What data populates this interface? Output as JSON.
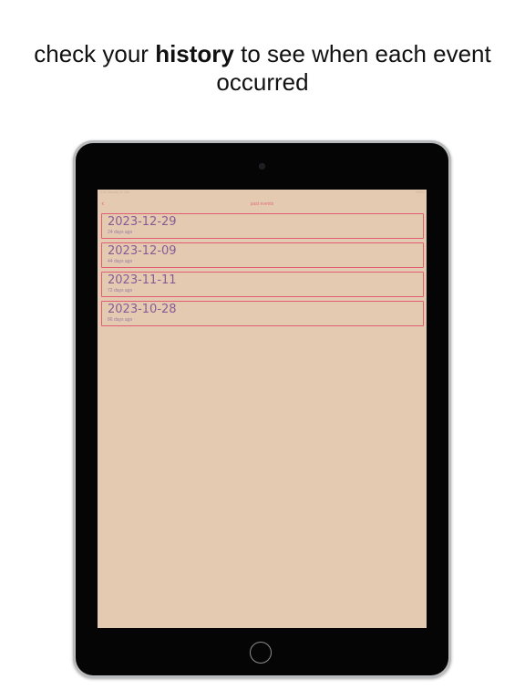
{
  "headline": {
    "prefix": "check your ",
    "emphasis": "history",
    "suffix": " to see when each event occurred"
  },
  "status_bar": {
    "left": "9:41  Monday 22 Jan",
    "right": "100%"
  },
  "nav": {
    "back_icon": "‹",
    "title": "past events"
  },
  "events": [
    {
      "date": "2023-12-29",
      "ago": "24 days ago"
    },
    {
      "date": "2023-12-09",
      "ago": "44 days ago"
    },
    {
      "date": "2023-11-11",
      "ago": "72 days ago"
    },
    {
      "date": "2023-10-28",
      "ago": "86 days ago"
    }
  ],
  "colors": {
    "screen_bg": "#e4cab0",
    "accent": "#e05c72",
    "date_text": "#8a5a96"
  },
  "icons": {
    "back": "chevron-left-icon"
  }
}
